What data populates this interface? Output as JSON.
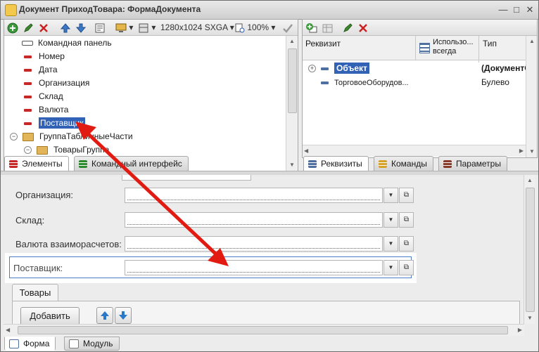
{
  "window": {
    "title": "Документ ПриходТовара: ФормаДокумента"
  },
  "left_toolbar": {
    "resolution": "1280x1024 SXGA",
    "zoom": "100%"
  },
  "elements_tree": {
    "items": [
      {
        "label": "Командная панель",
        "kind": "command-panel"
      },
      {
        "label": "Номер",
        "kind": "field"
      },
      {
        "label": "Дата",
        "kind": "field"
      },
      {
        "label": "Организация",
        "kind": "field"
      },
      {
        "label": "Склад",
        "kind": "field"
      },
      {
        "label": "Валюта",
        "kind": "field"
      },
      {
        "label": "Поставщик",
        "kind": "field",
        "selected": true
      },
      {
        "label": "ГруппаТабличныеЧасти",
        "kind": "group"
      },
      {
        "label": "ТоварыГруппа",
        "kind": "group"
      }
    ]
  },
  "left_tabs": [
    {
      "label": "Элементы"
    },
    {
      "label": "Командный интерфейс"
    }
  ],
  "attributes": {
    "columns": {
      "name": "Реквизит",
      "always": "Использо... всегда",
      "type": "Тип"
    },
    "rows": [
      {
        "name": "Объект",
        "type": "(ДокументОб"
      },
      {
        "name": "ТорговоеОборудов...",
        "type": "Булево"
      }
    ]
  },
  "right_tabs": [
    {
      "label": "Реквизиты"
    },
    {
      "label": "Команды"
    },
    {
      "label": "Параметры"
    }
  ],
  "form": {
    "fields": [
      {
        "label": "Организация:"
      },
      {
        "label": "Склад:"
      },
      {
        "label": "Валюта взаиморасчетов:"
      },
      {
        "label": "Поставщик:"
      }
    ],
    "page_tab": "Товары",
    "add_button": "Добавить"
  },
  "bottom_tabs": [
    {
      "label": "Форма"
    },
    {
      "label": "Модуль"
    }
  ],
  "colors": {
    "selection": "#3162b5",
    "annotation_arrow": "#e21b12",
    "required_marker": "#c62828"
  }
}
